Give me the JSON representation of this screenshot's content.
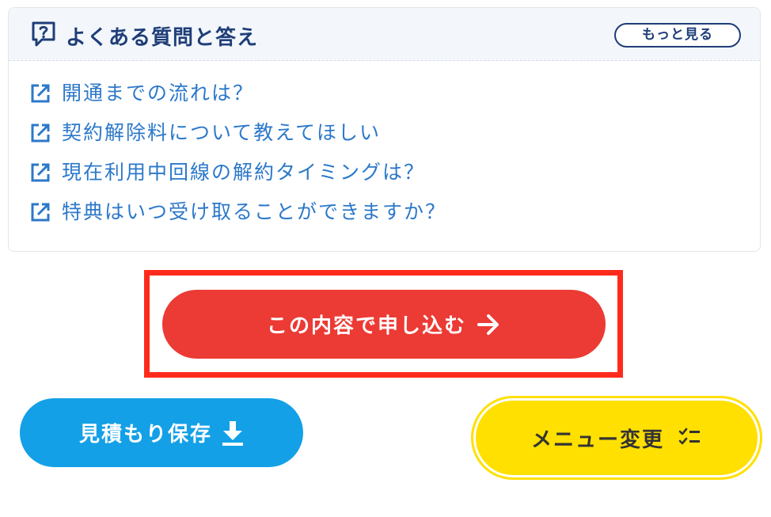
{
  "faq": {
    "title": "よくある質問と答え",
    "more_label": "もっと見る",
    "items": [
      {
        "label": "開通までの流れは？"
      },
      {
        "label": "契約解除料について教えてほしい"
      },
      {
        "label": "現在利用中回線の解約タイミングは？"
      },
      {
        "label": "特典はいつ受け取ることができますか？"
      }
    ],
    "icons": {
      "header": "question-bubble-icon",
      "item": "external-link-icon"
    }
  },
  "actions": {
    "apply_label": "この内容で申し込む",
    "save_label": "見積もり保存",
    "menu_label": "メニュー変更",
    "icons": {
      "apply": "arrow-right-icon",
      "save": "download-icon",
      "menu": "checklist-icon"
    }
  },
  "colors": {
    "heading_navy": "#1f3e78",
    "link_blue": "#2c78c9",
    "apply_red": "#ec3a34",
    "highlight_red": "#fe2b1c",
    "save_blue": "#14a0e6",
    "menu_yellow": "#ffe000"
  }
}
